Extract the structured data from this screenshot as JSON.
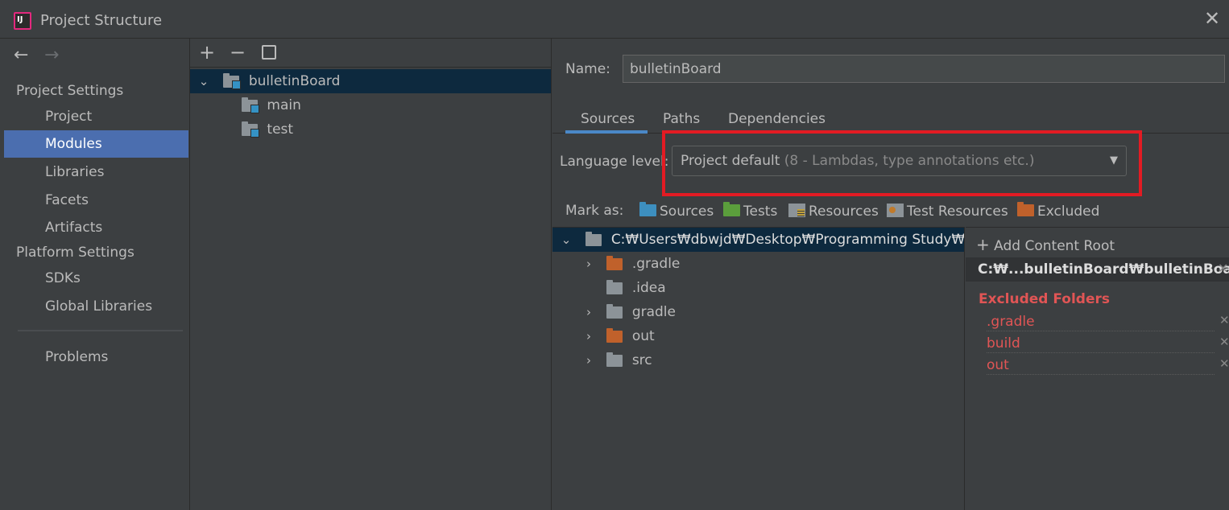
{
  "window": {
    "title": "Project Structure",
    "app_icon": "IJ"
  },
  "sidebar": {
    "back_icon": "arrow-left-icon",
    "forward_icon": "arrow-right-icon",
    "project_settings_header": "Project Settings",
    "project_items": [
      {
        "label": "Project",
        "selected": false
      },
      {
        "label": "Modules",
        "selected": true
      },
      {
        "label": "Libraries",
        "selected": false
      },
      {
        "label": "Facets",
        "selected": false
      },
      {
        "label": "Artifacts",
        "selected": false
      }
    ],
    "platform_settings_header": "Platform Settings",
    "platform_items": [
      {
        "label": "SDKs"
      },
      {
        "label": "Global Libraries"
      }
    ],
    "problems_label": "Problems"
  },
  "modules": {
    "toolbar": {
      "add": "+",
      "remove": "−",
      "copy_icon": "copy-icon"
    },
    "tree": {
      "root": "bulletinBoard",
      "children": [
        "main",
        "test"
      ]
    }
  },
  "detail": {
    "name_label": "Name:",
    "name_value": "bulletinBoard",
    "tabs": [
      {
        "label": "Sources",
        "active": true
      },
      {
        "label": "Paths",
        "active": false
      },
      {
        "label": "Dependencies",
        "active": false
      }
    ],
    "language_level": {
      "label": "Language level:",
      "value": "Project default",
      "hint": "(8 - Lambdas, type annotations etc.)"
    },
    "mark_as": {
      "label": "Mark as:",
      "buttons": [
        "Sources",
        "Tests",
        "Resources",
        "Test Resources",
        "Excluded"
      ]
    },
    "content_tree": {
      "root_path": "C:₩Users₩dbwjd₩Desktop₩Programming Study₩혼자",
      "folders": [
        {
          "name": ".gradle",
          "expandable": true,
          "excluded": true
        },
        {
          "name": ".idea",
          "expandable": false,
          "excluded": false
        },
        {
          "name": "gradle",
          "expandable": true,
          "excluded": false
        },
        {
          "name": "out",
          "expandable": true,
          "excluded": true
        },
        {
          "name": "src",
          "expandable": true,
          "excluded": false
        }
      ]
    },
    "content_root_panel": {
      "add_label": "Add Content Root",
      "root_path": "C:₩...bulletinBoard₩bulletinBoard",
      "excluded_header": "Excluded Folders",
      "excluded": [
        ".gradle",
        "build",
        "out"
      ]
    }
  },
  "colors": {
    "background": "#3c3f41",
    "selection": "#4b6eaf",
    "tree_selection": "#0d293e",
    "excluded": "#e05555",
    "highlight_box": "#e31b23",
    "tab_underline": "#4a88c7"
  }
}
